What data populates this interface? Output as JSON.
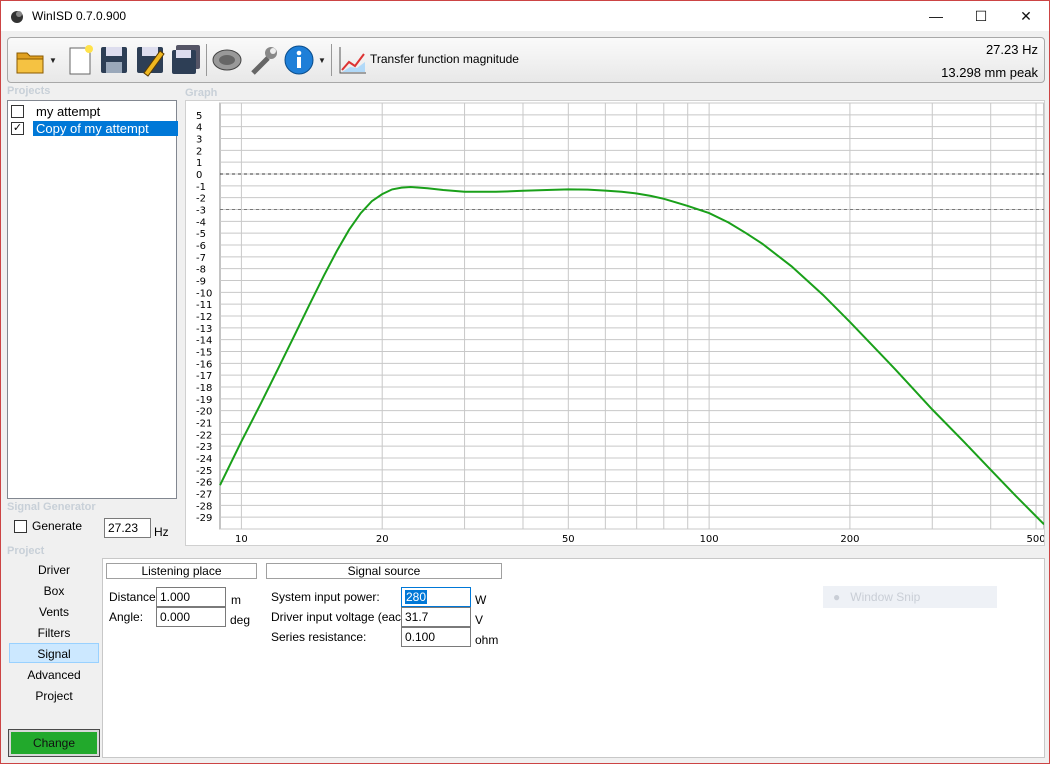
{
  "window": {
    "title": "WinISD 0.7.0.900",
    "min": "—",
    "max": "☐",
    "close": "✕"
  },
  "toolbar": {
    "transfer_label": "Transfer function magnitude",
    "freq_readout": "27.23 Hz",
    "excursion_readout": "13.298 mm peak"
  },
  "projects": {
    "label": "Projects",
    "items": [
      {
        "name": "my attempt",
        "checked": false
      },
      {
        "name": "Copy of my attempt",
        "checked": true,
        "selected": true
      }
    ]
  },
  "graph_label": "Graph",
  "signal_generator": {
    "label": "Signal Generator",
    "generate_label": "Generate",
    "frequency": "27.23",
    "unit": "Hz"
  },
  "project_nav": {
    "label": "Project",
    "items": [
      "Driver",
      "Box",
      "Vents",
      "Filters",
      "Signal",
      "Advanced",
      "Project"
    ],
    "active": "Signal",
    "change_label": "Change"
  },
  "panel": {
    "listening_place": {
      "heading": "Listening place",
      "distance_label": "Distance:",
      "distance_value": "1.000",
      "distance_unit": "m",
      "angle_label": "Angle:",
      "angle_value": "0.000",
      "angle_unit": "deg"
    },
    "signal_source": {
      "heading": "Signal source",
      "power_label": "System input power:",
      "power_value": "280",
      "power_unit": "W",
      "voltage_label": "Driver input voltage (each):",
      "voltage_value": "31.7",
      "voltage_unit": "V",
      "resistance_label": "Series resistance:",
      "resistance_value": "0.100",
      "resistance_unit": "ohm"
    }
  },
  "window_snip": "Window Snip",
  "colors": {
    "curve": "#1aa01a",
    "selection": "#0078d7",
    "change_button": "#22a92c"
  },
  "chart_data": {
    "type": "line",
    "xscale": "log",
    "xlim": [
      9,
      520
    ],
    "ylim": [
      -30,
      6
    ],
    "x_ticks": [
      10,
      20,
      50,
      100,
      200,
      500
    ],
    "y_ticks": [
      5,
      4,
      3,
      2,
      1,
      0,
      -1,
      -2,
      -3,
      -4,
      -5,
      -6,
      -7,
      -8,
      -9,
      -10,
      -11,
      -12,
      -13,
      -14,
      -15,
      -16,
      -17,
      -18,
      -19,
      -20,
      -21,
      -22,
      -23,
      -24,
      -25,
      -26,
      -27,
      -28,
      -29
    ],
    "reference_lines": [
      0,
      -3
    ],
    "grid": true,
    "series": [
      {
        "x": [
          9,
          10,
          11,
          12,
          13,
          14,
          15,
          16,
          17,
          18,
          19,
          20,
          21,
          22,
          23,
          24,
          25,
          27,
          30,
          35,
          40,
          45,
          50,
          55,
          60,
          65,
          70,
          75,
          80,
          85,
          90,
          100,
          110,
          120,
          130,
          150,
          175,
          200,
          250,
          300,
          350,
          400,
          450,
          520
        ],
        "y": [
          -26.3,
          -22.6,
          -19.4,
          -16.4,
          -13.6,
          -11.0,
          -8.6,
          -6.5,
          -4.7,
          -3.3,
          -2.3,
          -1.7,
          -1.3,
          -1.15,
          -1.1,
          -1.15,
          -1.2,
          -1.35,
          -1.5,
          -1.5,
          -1.42,
          -1.35,
          -1.3,
          -1.32,
          -1.4,
          -1.5,
          -1.65,
          -1.85,
          -2.1,
          -2.4,
          -2.7,
          -3.3,
          -4.1,
          -5.0,
          -5.9,
          -7.8,
          -10.2,
          -12.5,
          -16.5,
          -19.9,
          -22.6,
          -25.0,
          -27.1,
          -29.6
        ]
      }
    ]
  }
}
